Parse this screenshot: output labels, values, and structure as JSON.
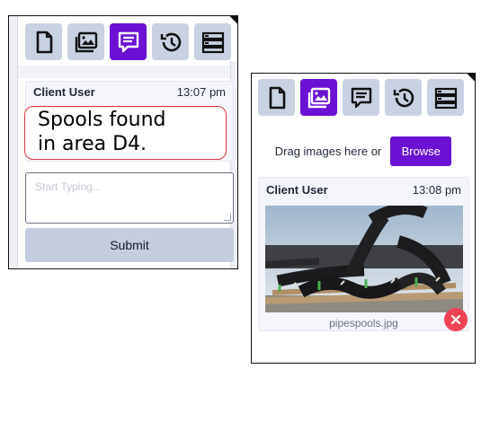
{
  "left_panel": {
    "toolbar": {
      "buttons": [
        {
          "icon": "document-icon",
          "active": false
        },
        {
          "icon": "image-icon",
          "active": false
        },
        {
          "icon": "chat-icon",
          "active": true
        },
        {
          "icon": "history-icon",
          "active": false
        },
        {
          "icon": "list-icon",
          "active": false
        }
      ]
    },
    "message": {
      "user": "Client User",
      "time": "13:07 pm",
      "text": "Spools found\nin area D4."
    },
    "compose": {
      "placeholder": "Start Typing..."
    },
    "submit_label": "Submit"
  },
  "right_panel": {
    "toolbar": {
      "buttons": [
        {
          "icon": "document-icon",
          "active": false
        },
        {
          "icon": "image-icon",
          "active": true
        },
        {
          "icon": "chat-icon",
          "active": false
        },
        {
          "icon": "history-icon",
          "active": false
        },
        {
          "icon": "list-icon",
          "active": false
        }
      ]
    },
    "upload": {
      "text": "Drag images here or",
      "browse_label": "Browse"
    },
    "message": {
      "user": "Client User",
      "time": "13:08 pm",
      "filename": "pipespools.jpg"
    }
  },
  "colors": {
    "accent": "#6a11d4",
    "toolbar_button": "#c9d2e3",
    "submit": "#c4cee0",
    "remove": "#ef4455",
    "annotation": "#d9363e"
  }
}
